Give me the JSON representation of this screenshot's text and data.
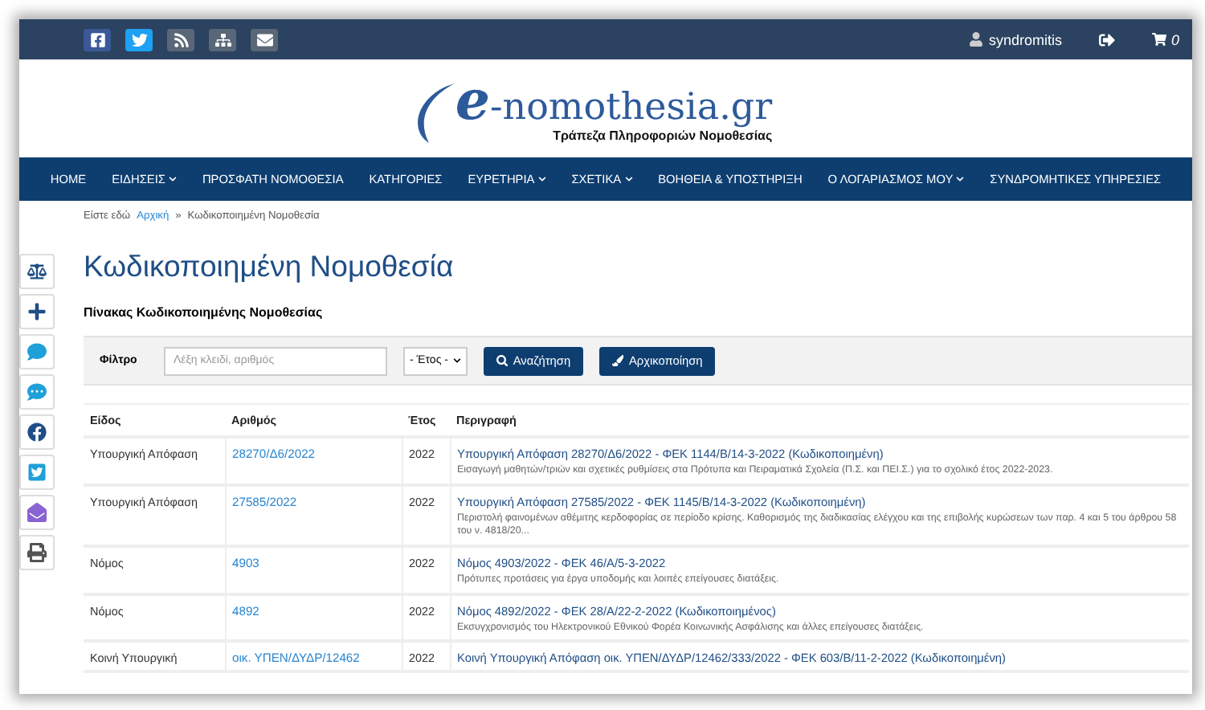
{
  "top_bar": {
    "social": [
      {
        "kind": "facebook"
      },
      {
        "kind": "twitter"
      },
      {
        "kind": "rss"
      },
      {
        "kind": "sitemap"
      },
      {
        "kind": "mail"
      }
    ],
    "user": "syndromitis",
    "cart_count": "0"
  },
  "logo": {
    "mark": "e",
    "name": "-nomothesia.gr",
    "tagline": "Τράπεζα Πληροφοριών Νομοθεσίας"
  },
  "nav": [
    {
      "label": "HOME",
      "dropdown": false
    },
    {
      "label": "ΕΙΔΗΣΕΙΣ",
      "dropdown": true
    },
    {
      "label": "ΠΡΟΣΦΑΤΗ ΝΟΜΟΘΕΣΙΑ",
      "dropdown": false
    },
    {
      "label": "ΚΑΤΗΓΟΡΙΕΣ",
      "dropdown": false
    },
    {
      "label": "ΕΥΡΕΤΗΡΙΑ",
      "dropdown": true
    },
    {
      "label": "ΣΧΕΤΙΚΑ",
      "dropdown": true
    },
    {
      "label": "ΒΟΗΘΕΙΑ & ΥΠΟΣΤΗΡΙΞΗ",
      "dropdown": false
    },
    {
      "label": "Ο ΛΟΓΑΡΙΑΣΜΟΣ ΜΟΥ",
      "dropdown": true
    },
    {
      "label": "ΣΥΝΔΡΟΜΗΤΙΚΕΣ ΥΠΗΡΕΣΙΕΣ",
      "dropdown": false
    }
  ],
  "breadcrumb": {
    "prefix": "Είστε εδώ",
    "home": "Αρχική",
    "separator": "»",
    "current": "Κωδικοποιημένη Νομοθεσία"
  },
  "side_tools": [
    {
      "kind": "scale"
    },
    {
      "kind": "plus"
    },
    {
      "kind": "comment"
    },
    {
      "kind": "comment-dots"
    },
    {
      "kind": "facebook"
    },
    {
      "kind": "twitter"
    },
    {
      "kind": "envelope"
    },
    {
      "kind": "print"
    }
  ],
  "title": "Κωδικοποιημένη Νομοθεσία",
  "subtitle": "Πίνακας Κωδικοποιημένης Νομοθεσίας",
  "filter": {
    "label": "Φίλτρο",
    "placeholder": "Λέξη κλειδί, αριθμός",
    "year": "- Έτος -",
    "search": "Αναζήτηση",
    "reset": "Αρχικοποίηση"
  },
  "table": {
    "columns": [
      "Είδος",
      "Αριθμός",
      "Έτος",
      "Περιγραφή"
    ],
    "rows": [
      {
        "type": "Υπουργική Απόφαση",
        "number": "28270/Δ6/2022",
        "year": "2022",
        "title": "Υπουργική Απόφαση 28270/Δ6/2022 - ΦΕΚ 1144/Β/14-3-2022 (Κωδικοποιημένη)",
        "summary": "Εισαγωγή μαθητών/τριών και σχετικές ρυθμίσεις στα Πρότυπα και Πειραματικά Σχολεία (Π.Σ. και ΠΕΙ.Σ.) για το σχολικό έτος 2022-2023."
      },
      {
        "type": "Υπουργική Απόφαση",
        "number": "27585/2022",
        "year": "2022",
        "title": "Υπουργική Απόφαση 27585/2022 - ΦΕΚ 1145/Β/14-3-2022 (Κωδικοποιημένη)",
        "summary": "Περιστολή φαινομένων αθέμιτης κερδοφορίας σε περίοδο κρίσης. Καθορισμός της διαδικασίας ελέγχου και της επιβολής κυρώσεων των παρ. 4 και 5 του άρθρου 58 του ν. 4818/20..."
      },
      {
        "type": "Νόμος",
        "number": "4903",
        "year": "2022",
        "title": "Νόμος 4903/2022 - ΦΕΚ 46/Α/5-3-2022",
        "summary": "Πρότυπες προτάσεις για έργα υποδομής και λοιπές επείγουσες διατάξεις."
      },
      {
        "type": "Νόμος",
        "number": "4892",
        "year": "2022",
        "title": "Νόμος 4892/2022 - ΦΕΚ 28/Α/22-2-2022 (Κωδικοποιημένος)",
        "summary": "Εκσυγχρονισμός του Ηλεκτρονικού Εθνικού Φορέα Κοινωνικής Ασφάλισης και άλλες επείγουσες διατάξεις."
      },
      {
        "type": "Κοινή Υπουργική",
        "number": "οικ. ΥΠΕΝ/ΔΥΔΡ/12462",
        "year": "2022",
        "title": "Κοινή Υπουργική Απόφαση οικ. ΥΠΕΝ/ΔΥΔΡ/12462/333/2022 - ΦΕΚ 603/Β/11-2-2022 (Κωδικοποιημένη)"
      }
    ]
  }
}
